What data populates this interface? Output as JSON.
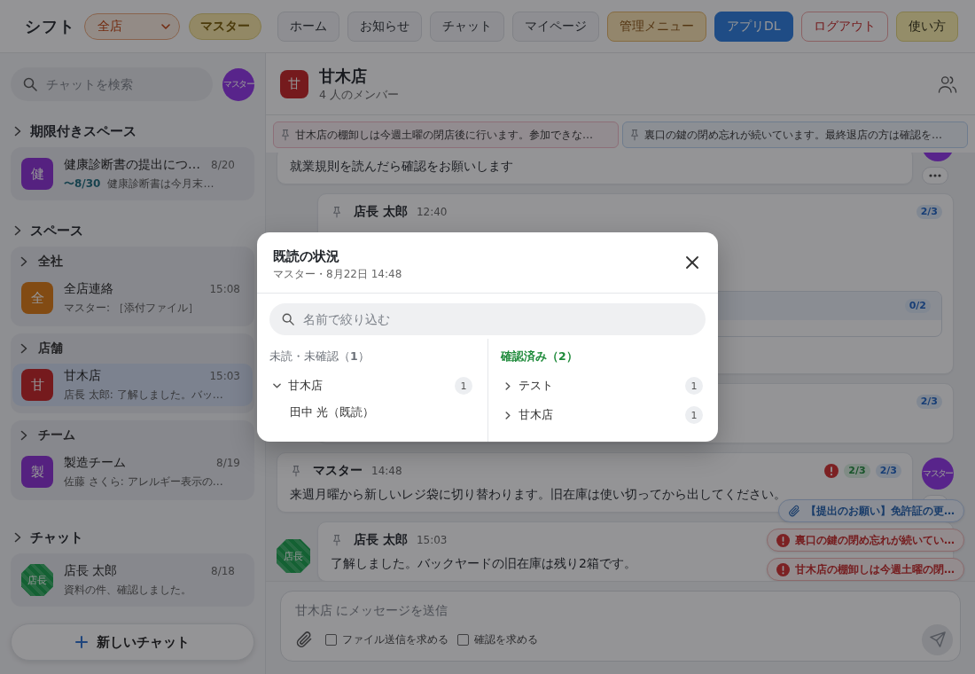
{
  "topbar": {
    "title": "シフト",
    "store_select": {
      "value": "全店"
    },
    "role": "マスター",
    "nav": [
      {
        "label": "ホーム",
        "kind": "plain"
      },
      {
        "label": "お知らせ",
        "kind": "plain"
      },
      {
        "label": "チャット",
        "kind": "plain"
      },
      {
        "label": "マイページ",
        "kind": "plain"
      },
      {
        "label": "管理メニュー",
        "kind": "admin"
      },
      {
        "label": "アプリDL",
        "kind": "primary"
      },
      {
        "label": "ログアウト",
        "kind": "danger"
      },
      {
        "label": "使い方",
        "kind": "help"
      }
    ]
  },
  "sidebar": {
    "search": {
      "placeholder": "チャットを検索"
    },
    "user_avatar": {
      "text": "マスター",
      "color": "#59248b"
    },
    "sections": [
      {
        "title": "期限付きスペース",
        "groups": [
          {
            "items": [
              {
                "name": "健康診断書の提出につ…",
                "time": "8/20",
                "deadline": "〜8/30",
                "preview": "健康診断書は今月末…",
                "avatar": {
                  "kind": "tile",
                  "text": "健",
                  "color": "#552280"
                },
                "selected": false
              }
            ]
          }
        ]
      },
      {
        "title": "スペース",
        "groups": [
          {
            "title": "全社",
            "items": [
              {
                "name": "全店連絡",
                "time": "15:08",
                "preview": "マスター: ［添付ファイル］",
                "avatar": {
                  "kind": "tile",
                  "text": "全",
                  "color": "#834b13"
                },
                "selected": false
              }
            ]
          },
          {
            "title": "店舗",
            "items": [
              {
                "name": "甘木店",
                "time": "15:03",
                "preview": "店長 太郎: 了解しました。バッ…",
                "avatar": {
                  "kind": "tile",
                  "text": "甘",
                  "color": "#751b1d"
                },
                "selected": true
              }
            ]
          },
          {
            "title": "チーム",
            "items": [
              {
                "name": "製造チーム",
                "time": "8/19",
                "preview": "佐藤 さくら: アレルギー表示の…",
                "avatar": {
                  "kind": "tile",
                  "text": "製",
                  "color": "#552280"
                },
                "selected": false
              }
            ]
          }
        ]
      },
      {
        "title": "チャット",
        "groups": [
          {
            "items": [
              {
                "name": "店長 太郎",
                "time": "8/18",
                "preview": "資料の件、確認しました。",
                "avatar": {
                  "kind": "octagon",
                  "text": "店長",
                  "color": "#146233"
                },
                "selected": false
              }
            ]
          }
        ]
      }
    ],
    "new_chat": "新しいチャット"
  },
  "chat": {
    "title": "甘木店",
    "avatar": {
      "text": "甘",
      "color": "#751b1d"
    },
    "members": "4 人のメンバー",
    "pinned": [
      {
        "text": "甘木店の棚卸しは今週土曜の閉店後に行います。参加できな…",
        "color": "#8d6f78"
      },
      {
        "text": "裏口の鍵の閉め忘れが続いています。最終退店の方は確認を…",
        "color": "#6f7c8e"
      }
    ],
    "messages": [
      {
        "kind": "own",
        "body": "就業規則を読んだら確認をお願いします",
        "avatar": {
          "kind": "circle",
          "color": "#59248b"
        }
      },
      {
        "kind": "other",
        "author": "店長 太郎",
        "time": "12:40",
        "alert": false,
        "badges": [
          {
            "text": "2/3",
            "kind": "read"
          }
        ],
        "inner_box": {
          "badge": {
            "text": "0/2",
            "kind": "read"
          }
        }
      },
      {
        "kind": "other",
        "alert": false,
        "badges": [
          {
            "text": "2/3",
            "kind": "read"
          }
        ]
      },
      {
        "kind": "own",
        "author": "マスター",
        "time": "14:48",
        "alert": true,
        "badges": [
          {
            "text": "2/3",
            "kind": "confirmed"
          },
          {
            "text": "2/3",
            "kind": "read"
          }
        ],
        "body": "来週月曜から新しいレジ袋に切り替わります。旧在庫は使い切ってから出してください。",
        "avatar": {
          "kind": "circle",
          "text": "マスター",
          "color": "#59248b"
        }
      },
      {
        "kind": "other",
        "author": "店長 太郎",
        "time": "15:03",
        "alert": false,
        "body": "了解しました。バックヤードの旧在庫は残り2箱です。",
        "avatar": {
          "kind": "octagon",
          "text": "店長",
          "color": "#146233"
        }
      }
    ],
    "floating": [
      {
        "kind": "file",
        "text": "【提出のお願い】免許証の更…"
      },
      {
        "kind": "confirm",
        "text": "裏口の鍵の閉め忘れが続いてい…"
      },
      {
        "kind": "confirm",
        "text": "甘木店の棚卸しは今週土曜の閉…"
      }
    ],
    "composer": {
      "placeholder": "甘木店 にメッセージを送信",
      "options": [
        {
          "label": "ファイル送信を求める",
          "checked": false
        },
        {
          "label": "確認を求める",
          "checked": false
        }
      ]
    }
  },
  "dialog": {
    "title": "既読の状況",
    "subtitle": "マスター・8月22日 14:48",
    "search": {
      "placeholder": "名前で絞り込む"
    },
    "columns": [
      {
        "kind": "unread",
        "title": "未読・未確認（**1**）",
        "groups": [
          {
            "name": "甘木店",
            "count": "1",
            "expanded": true,
            "children": [
              {
                "name": "田中 光（既読）"
              }
            ]
          }
        ]
      },
      {
        "kind": "confirmed",
        "title": "確認済み（**2**）",
        "groups": [
          {
            "name": "テスト",
            "count": "1",
            "expanded": false
          },
          {
            "name": "甘木店",
            "count": "1",
            "expanded": false
          }
        ]
      }
    ]
  }
}
